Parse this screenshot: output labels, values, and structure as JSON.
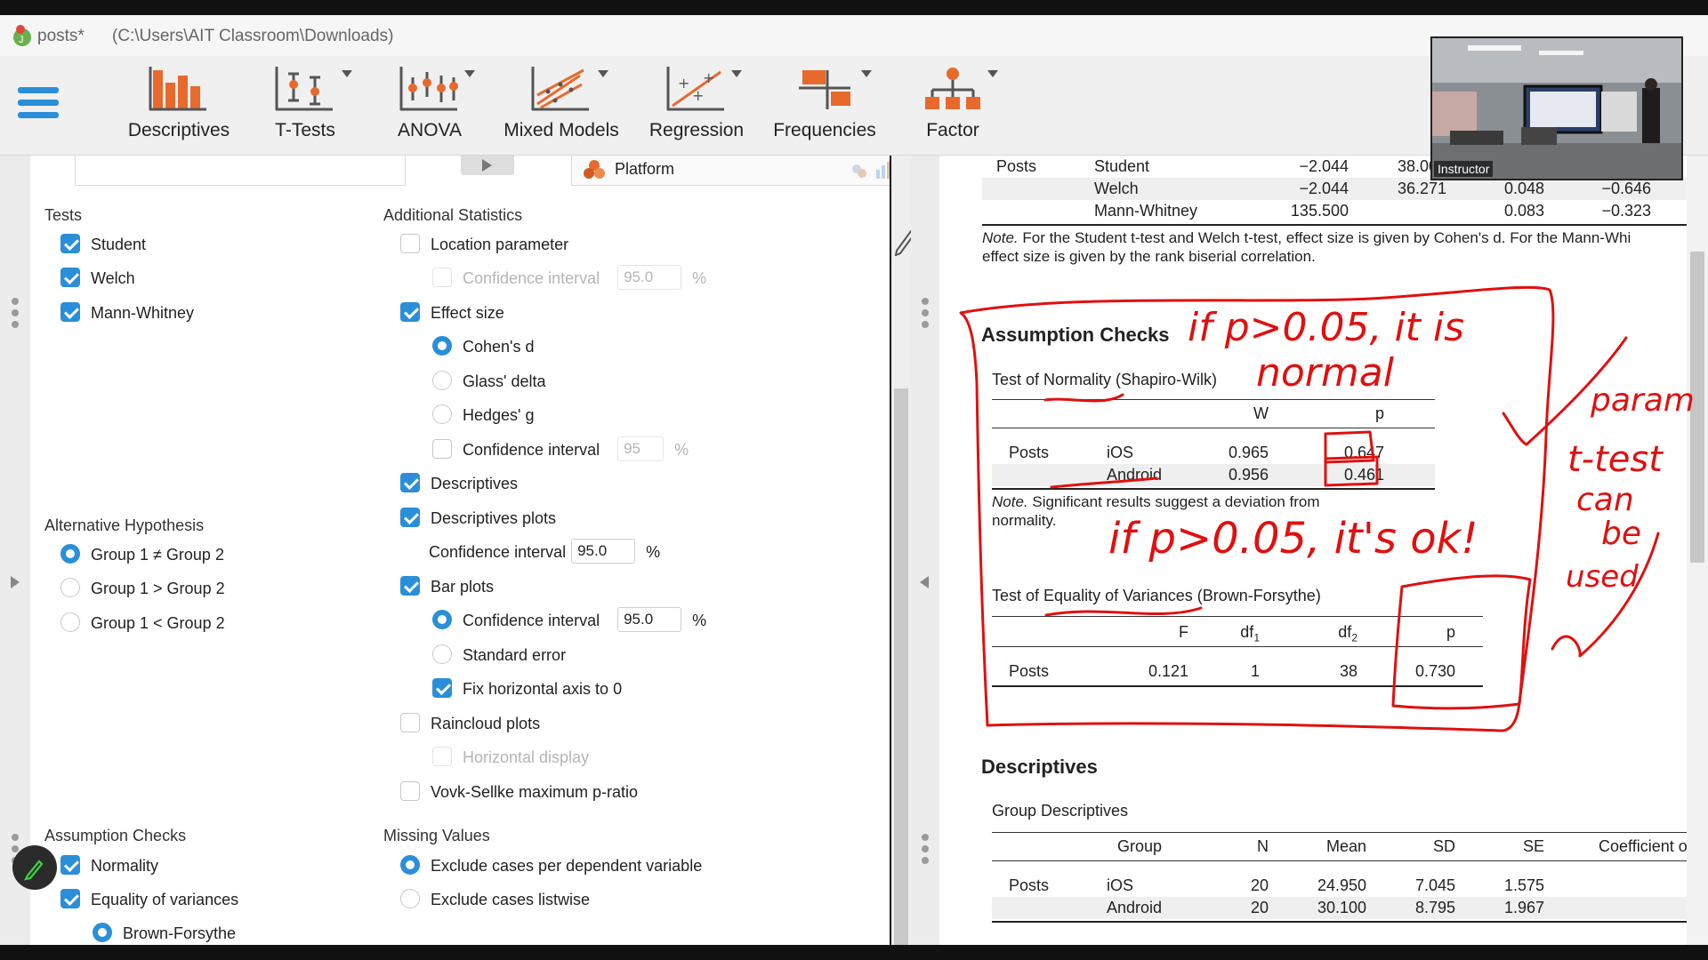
{
  "window": {
    "doc_name": "posts*",
    "doc_path": "(C:\\Users\\AIT Classroom\\Downloads)"
  },
  "ribbon": {
    "items": [
      {
        "label": "Descriptives",
        "icon": "bar-chart-icon"
      },
      {
        "label": "T-Tests",
        "icon": "ttest-icon"
      },
      {
        "label": "ANOVA",
        "icon": "anova-icon"
      },
      {
        "label": "Mixed Models",
        "icon": "mixed-models-icon"
      },
      {
        "label": "Regression",
        "icon": "regression-icon"
      },
      {
        "label": "Frequencies",
        "icon": "frequencies-icon"
      },
      {
        "label": "Factor",
        "icon": "factor-icon"
      }
    ]
  },
  "options": {
    "grouping_variable": "Platform",
    "tests": {
      "title": "Tests",
      "items": [
        {
          "label": "Student",
          "checked": true
        },
        {
          "label": "Welch",
          "checked": true
        },
        {
          "label": "Mann-Whitney",
          "checked": true
        }
      ]
    },
    "additional": {
      "title": "Additional Statistics",
      "location_parameter": "Location parameter",
      "loc_ci_label": "Confidence interval",
      "loc_ci_value": "95.0",
      "effect_size": "Effect size",
      "cohens_d": "Cohen's d",
      "glass_delta": "Glass' delta",
      "hedges_g": "Hedges' g",
      "es_ci_label": "Confidence interval",
      "es_ci_value": "95",
      "descriptives": "Descriptives",
      "descriptives_plots": "Descriptives plots",
      "dp_ci_label": "Confidence interval",
      "dp_ci_value": "95.0",
      "bar_plots": "Bar plots",
      "bp_ci_label": "Confidence interval",
      "bp_ci_value": "95.0",
      "standard_error": "Standard error",
      "fix_axis": "Fix horizontal axis to 0",
      "raincloud": "Raincloud plots",
      "horizontal_display": "Horizontal display",
      "vovk_sellke": "Vovk-Sellke maximum p-ratio",
      "percent": "%"
    },
    "alt_hypothesis": {
      "title": "Alternative Hypothesis",
      "items": [
        {
          "label": "Group 1 ≠ Group 2",
          "selected": true
        },
        {
          "label": "Group 1 > Group 2",
          "selected": false
        },
        {
          "label": "Group 1 < Group 2",
          "selected": false
        }
      ]
    },
    "assumption_checks": {
      "title": "Assumption Checks",
      "normality": "Normality",
      "equality": "Equality of variances",
      "brown_forsythe": "Brown-Forsythe"
    },
    "missing_values": {
      "title": "Missing Values",
      "per_dv": "Exclude cases per dependent variable",
      "listwise": "Exclude cases listwise"
    }
  },
  "results": {
    "ttest_rows": [
      {
        "var": "Posts",
        "test": "Student",
        "stat": "−2.044",
        "df": "38.000",
        "p": "",
        "es": ""
      },
      {
        "var": "",
        "test": "Welch",
        "stat": "−2.044",
        "df": "36.271",
        "p": "0.048",
        "es": "−0.646"
      },
      {
        "var": "",
        "test": "Mann-Whitney",
        "stat": "135.500",
        "df": "",
        "p": "0.083",
        "es": "−0.323"
      }
    ],
    "ttest_note_label": "Note.",
    "ttest_note_line1": " For the Student t-test and Welch t-test, effect size is given by Cohen's d. For the Mann-Whi",
    "ttest_note_line2": "effect size is given by the rank biserial correlation.",
    "assumption_title": "Assumption Checks",
    "normality": {
      "caption": "Test of Normality (Shapiro-Wilk)",
      "col_w": "W",
      "col_p": "p",
      "var": "Posts",
      "rows": [
        {
          "group": "iOS",
          "w": "0.965",
          "p": "0.647"
        },
        {
          "group": "Android",
          "w": "0.956",
          "p": "0.461"
        }
      ],
      "note_label": "Note.",
      "note_line1": " Significant results suggest a deviation from",
      "note_line2": "normality."
    },
    "variances": {
      "caption": "Test of Equality of Variances (Brown-Forsythe)",
      "col_f": "F",
      "col_df1": "df",
      "col_df1_sub": "1",
      "col_df2": "df",
      "col_df2_sub": "2",
      "col_p": "p",
      "row": {
        "var": "Posts",
        "f": "0.121",
        "df1": "1",
        "df2": "38",
        "p": "0.730"
      }
    },
    "descriptives_title": "Descriptives",
    "group_desc": {
      "caption": "Group Descriptives",
      "cols": [
        "Group",
        "N",
        "Mean",
        "SD",
        "SE",
        "Coefficient o"
      ],
      "var": "Posts",
      "rows": [
        {
          "group": "iOS",
          "n": "20",
          "mean": "24.950",
          "sd": "7.045",
          "se": "1.575"
        },
        {
          "group": "Android",
          "n": "20",
          "mean": "30.100",
          "sd": "8.795",
          "se": "1.967"
        }
      ]
    }
  },
  "webcam": {
    "label": "Instructor"
  },
  "annotations": {
    "color": "#e01010",
    "text1_a": "if p>0.05, it is",
    "text1_b": "normal",
    "text2": "if p>0.05, it's ok!",
    "text3_a": "param",
    "text3_b": "t-test",
    "text3_c": "can",
    "text3_d": "be",
    "text3_e": "used"
  }
}
